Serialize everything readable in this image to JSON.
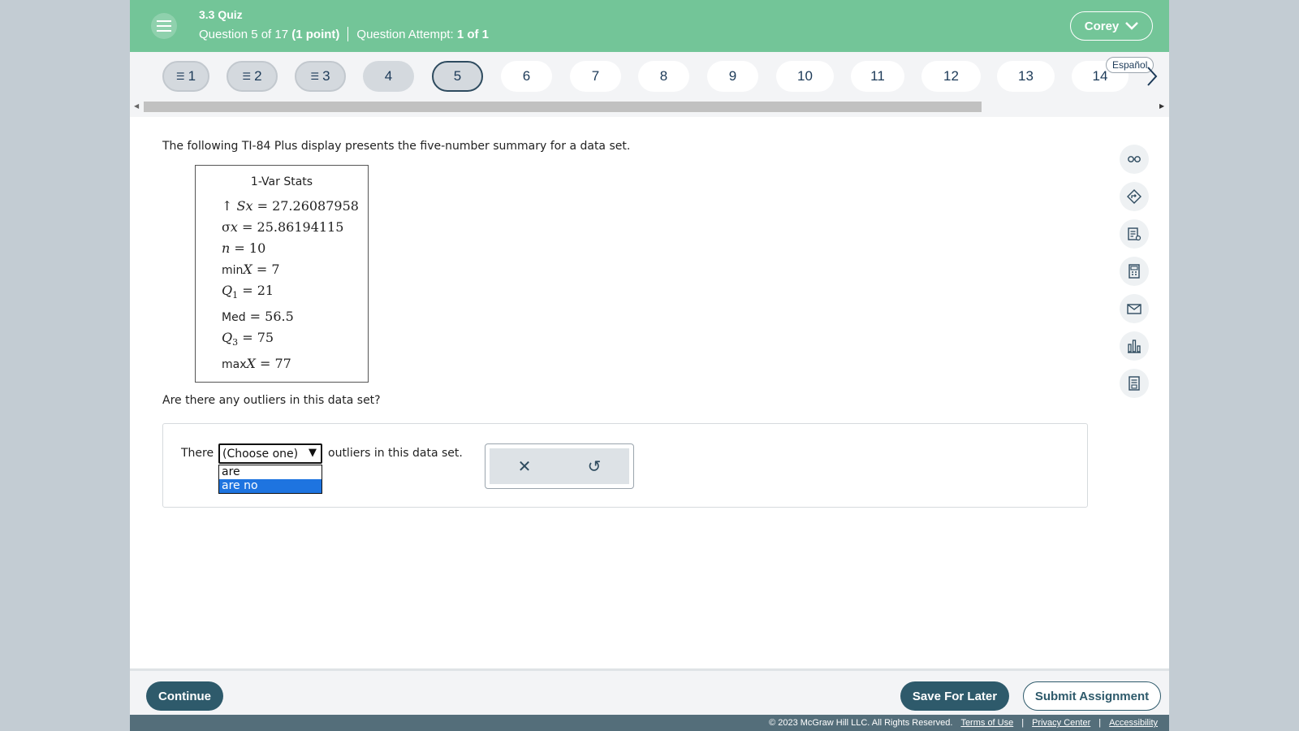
{
  "header": {
    "quiz_title": "3.3 Quiz",
    "question_prefix": "Question 5 of 17",
    "question_points": "(1 point)",
    "attempt_label": "Question Attempt:",
    "attempt_value": "1 of 1",
    "user_name": "Corey"
  },
  "nav": {
    "questions": [
      "1",
      "2",
      "3",
      "4",
      "5",
      "6",
      "7",
      "8",
      "9",
      "10",
      "11",
      "12",
      "13",
      "14"
    ],
    "current": "5",
    "espanol_label": "Español"
  },
  "content": {
    "prompt": "The following TI-84 Plus display presents the five-number summary for a data set.",
    "calc": {
      "title": "1-Var Stats",
      "sx_value": "27.26087958",
      "sigmax_value": "25.86194115",
      "n_value": "10",
      "minx_label": "min",
      "minx_value": "7",
      "q1_value": "21",
      "med_label": "Med",
      "med_value": "56.5",
      "q3_value": "75",
      "maxx_label": "max",
      "maxx_value": "77"
    },
    "question": "Are there any outliers in this data set?",
    "answer": {
      "before": "There",
      "select_value": "(Choose one)",
      "options": [
        "are",
        "are no"
      ],
      "selected_option": "are no",
      "after": "outliers in this data set."
    }
  },
  "footer": {
    "continue_label": "Continue",
    "save_label": "Save For Later",
    "submit_label": "Submit Assignment",
    "copyright": "© 2023 McGraw Hill LLC. All Rights Reserved.",
    "terms": "Terms of Use",
    "privacy": "Privacy Center",
    "accessibility": "Accessibility"
  },
  "colors": {
    "header_bg": "#73c598",
    "primary_button": "#2e5a6b",
    "selected_option": "#1e74e0",
    "legal_bar": "#546e7a"
  }
}
